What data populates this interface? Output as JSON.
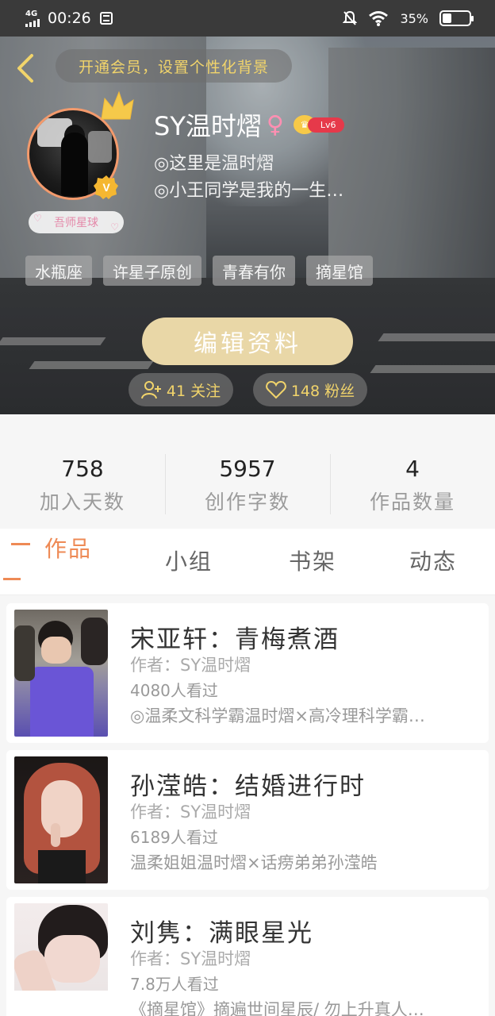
{
  "status_bar": {
    "network": "4G",
    "time": "00:26",
    "battery_percent_text": "35%",
    "battery_level": 0.35
  },
  "header": {
    "vip_banner": "开通会员，设置个性化背景",
    "username": "SY温时熠",
    "gender_symbol": "♀",
    "level": "Lv6",
    "bio_line1": "◎这里是温时熠",
    "bio_line2": "◎小王同学是我的一生…",
    "badge_label": "吾师星球",
    "tags": [
      "水瓶座",
      "许星子原创",
      "青春有你",
      "摘星馆"
    ],
    "edit_button": "编辑资料",
    "following": "41 关注",
    "fans": "148 粉丝"
  },
  "stats": [
    {
      "value": "758",
      "label": "加入天数"
    },
    {
      "value": "5957",
      "label": "创作字数"
    },
    {
      "value": "4",
      "label": "作品数量"
    }
  ],
  "tabs": [
    "作品",
    "小组",
    "书架",
    "动态"
  ],
  "works": [
    {
      "title": "宋亚轩：青梅煮酒",
      "author": "作者：SY温时熠",
      "views": "4080人看过",
      "desc": "◎温柔文科学霸温时熠×高冷理科学霸…"
    },
    {
      "title": "孙滢皓：结婚进行时",
      "author": "作者：SY温时熠",
      "views": "6189人看过",
      "desc": "温柔姐姐温时熠×话痨弟弟孙滢皓"
    },
    {
      "title": "刘隽：满眼星光",
      "author": "作者：SY温时熠",
      "views": "7.8万人看过",
      "desc": "《摘星馆》摘遍世间星辰/ 勿上升真人…"
    }
  ],
  "colors": {
    "accent": "#ee8a55",
    "gold": "#f1d46b",
    "edit_button": "#e9d7a7",
    "level_badge": "#e6394a"
  }
}
